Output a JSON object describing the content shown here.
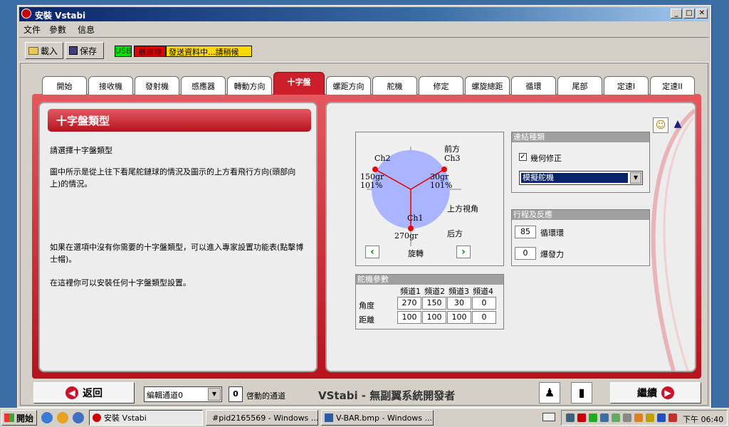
{
  "window": {
    "title": "安裝 Vstabi"
  },
  "menu": [
    "文件",
    "參數",
    "信息"
  ],
  "toolbar": {
    "load": "載入",
    "save": "保存"
  },
  "status": {
    "usb": "USB",
    "connection": "無連接",
    "message": "發送資料中...請稍候"
  },
  "tabs": [
    "開始",
    "接收機",
    "發射機",
    "感應器",
    "轉動方向",
    "十字盤",
    "螺距方向",
    "舵機",
    "修定",
    "螺旋總距",
    "循環",
    "尾部",
    "定速I",
    "定速II"
  ],
  "left_panel": {
    "title": "十字盤類型",
    "p1": "請選擇十字盤類型",
    "p2": "圖中所示是從上往下看尾舵鏈球的情況及圖示的上方看飛行方向(頭部向上)的情況。",
    "p3": "如果在選項中沒有你需要的十字盤類型，可以進入專家設置功能表(點擊博士帽)。",
    "p4": "在這裡你可以安裝任何十字盤類型設置。"
  },
  "diagram": {
    "front": "前方",
    "ch2": "Ch2",
    "ch3": "Ch3",
    "ch1": "Ch1",
    "ch2_angle": "150gr",
    "ch2_pct": "101%",
    "ch3_angle": "30gr",
    "ch3_pct": "101%",
    "ch1_angle": "270gr",
    "top_view": "上方視角",
    "rear": "后方",
    "rotate": "旋轉"
  },
  "link_type": {
    "title": "連結種類",
    "check_label": "幾何修正",
    "checked": true,
    "select_value": "模擬舵機"
  },
  "travel": {
    "title": "行程及反應",
    "cycle_value": "85",
    "cycle_label": "循環環",
    "burst_value": "0",
    "burst_label": "爆發力"
  },
  "servo_params": {
    "title": "舵機參數",
    "headers": [
      "頻道1",
      "頻道2",
      "頻道3",
      "頻道4"
    ],
    "rows": [
      {
        "label": "角度",
        "values": [
          "270",
          "150",
          "30",
          "0"
        ]
      },
      {
        "label": "距離",
        "values": [
          "100",
          "100",
          "100",
          "0"
        ]
      }
    ]
  },
  "bottom": {
    "back": "返回",
    "edit_channel": "編輯通道0",
    "active_count": "0",
    "active_label": "啓動的通道",
    "brand": "VStabi - 無副翼系統開發者",
    "continue": "繼續"
  },
  "taskbar": {
    "start": "開始",
    "tasks": [
      "安裝 Vstabi",
      "#pid2165569 - Windows ...",
      "V-BAR.bmp - Windows ..."
    ],
    "clock": "下午 06:40"
  }
}
